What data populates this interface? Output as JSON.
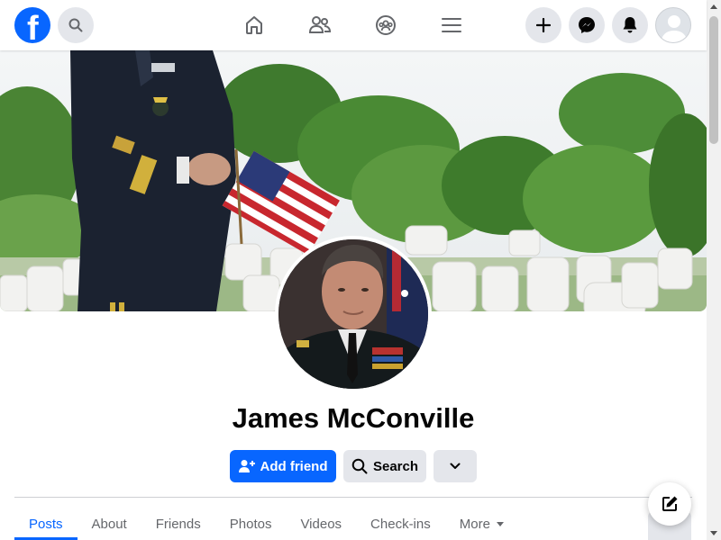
{
  "header": {
    "logo_letter": "f",
    "logo_icon": "facebook-logo-icon",
    "search_icon": "search-icon",
    "nav_icons": [
      "home-icon",
      "friends-icon",
      "groups-icon",
      "menu-icon"
    ],
    "action_icons": [
      "plus-icon",
      "messenger-icon",
      "bell-icon",
      "avatar"
    ],
    "accent_color": "#0866ff"
  },
  "cover": {
    "image": "cover-photo"
  },
  "profile": {
    "name": "James McConville",
    "picture": "profile-picture"
  },
  "actions": {
    "add_friend_label": "Add friend",
    "add_friend_icon": "add-person-icon",
    "search_label": "Search",
    "search_icon": "search-icon",
    "more_icon": "chevron-down-icon"
  },
  "tabs": [
    {
      "label": "Posts"
    },
    {
      "label": "About"
    },
    {
      "label": "Friends"
    },
    {
      "label": "Photos"
    },
    {
      "label": "Videos"
    },
    {
      "label": "Check-ins"
    },
    {
      "label": "More"
    }
  ],
  "active_tab": "Posts",
  "compose_icon": "compose-icon"
}
